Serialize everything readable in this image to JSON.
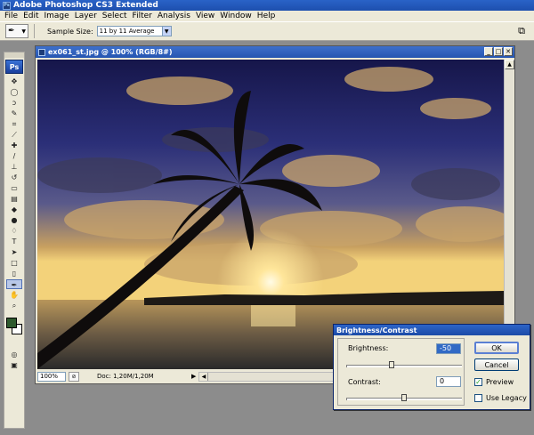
{
  "app": {
    "title": "Adobe Photoshop CS3 Extended",
    "logo": "Ps"
  },
  "menu": [
    "File",
    "Edit",
    "Image",
    "Layer",
    "Select",
    "Filter",
    "Analysis",
    "View",
    "Window",
    "Help"
  ],
  "options": {
    "tool_icon": "eyedropper-icon",
    "sample_size_label": "Sample Size:",
    "sample_size_value": "11 by 11 Average"
  },
  "document": {
    "title": "ex061_st.jpg @ 100% (RGB/8#)",
    "zoom": "100%",
    "doc_size": "Doc: 1,20M/1,20M"
  },
  "dialog": {
    "title": "Brightness/Contrast",
    "brightness_label": "Brightness:",
    "brightness_value": "-50",
    "brightness_level": 0.39,
    "contrast_label": "Contrast:",
    "contrast_value": "0",
    "contrast_level": 0.5,
    "ok_label": "OK",
    "cancel_label": "Cancel",
    "preview_label": "Preview",
    "preview_checked": true,
    "legacy_label": "Use Legacy",
    "legacy_checked": false
  },
  "colors": {
    "foreground": "#2e5a2e",
    "background": "#ffffff",
    "titlebar": "#2a63c7"
  }
}
